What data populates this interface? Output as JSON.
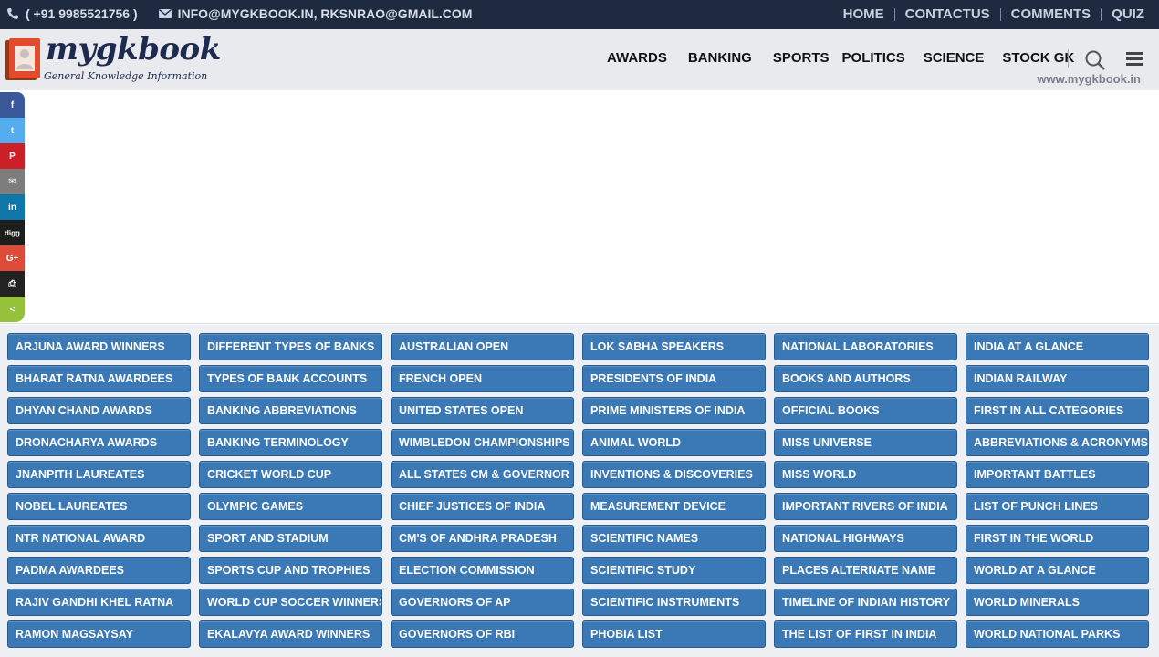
{
  "topbar": {
    "phone": "( +91 9985521756 )",
    "email": "INFO@MYGKBOOK.IN, RKSNRAO@GMAIL.COM",
    "nav": [
      "HOME",
      "CONTACTUS",
      "COMMENTS",
      "QUIZ"
    ]
  },
  "header": {
    "logo_title": "mygkbook",
    "logo_subtitle": "General Knowledge Information",
    "nav": [
      "AWARDS",
      "BANKING",
      "SPORTS",
      "POLITICS",
      "SCIENCE",
      "STOCK GK"
    ],
    "site_url": "www.mygkbook.in"
  },
  "share": [
    {
      "name": "facebook",
      "glyph": "f",
      "color": "#3b5998"
    },
    {
      "name": "twitter",
      "glyph": "t",
      "color": "#55acee"
    },
    {
      "name": "pinterest",
      "glyph": "P",
      "color": "#cb2027"
    },
    {
      "name": "email",
      "glyph": "✉",
      "color": "#7d7d7d"
    },
    {
      "name": "linkedin",
      "glyph": "in",
      "color": "#0e76a8"
    },
    {
      "name": "digg",
      "glyph": "digg",
      "color": "#1d1d1b"
    },
    {
      "name": "google-plus",
      "glyph": "G+",
      "color": "#dd4b39"
    },
    {
      "name": "print",
      "glyph": "⎙",
      "color": "#222222"
    },
    {
      "name": "share",
      "glyph": "<",
      "color": "#95c13d"
    }
  ],
  "link_columns": [
    [
      "ARJUNA AWARD WINNERS",
      "BHARAT RATNA AWARDEES",
      "DHYAN CHAND AWARDS",
      "DRONACHARYA AWARDS",
      "JNANPITH LAUREATES",
      "NOBEL LAUREATES",
      "NTR NATIONAL AWARD",
      "PADMA AWARDEES",
      "RAJIV GANDHI KHEL RATNA",
      "RAMON MAGSAYSAY"
    ],
    [
      "DIFFERENT TYPES OF BANKS",
      "TYPES OF BANK ACCOUNTS",
      "BANKING ABBREVIATIONS",
      "BANKING TERMINOLOGY",
      "CRICKET WORLD CUP",
      "OLYMPIC GAMES",
      "SPORT AND STADIUM",
      "SPORTS CUP AND TROPHIES",
      "WORLD CUP SOCCER WINNERS",
      "EKALAVYA AWARD WINNERS"
    ],
    [
      "AUSTRALIAN OPEN",
      "FRENCH OPEN",
      "UNITED STATES OPEN",
      "WIMBLEDON CHAMPIONSHIPS",
      "ALL STATES CM & GOVERNOR",
      "CHIEF JUSTICES OF INDIA",
      "CM'S OF ANDHRA PRADESH",
      "ELECTION COMMISSION",
      "GOVERNORS OF AP",
      "GOVERNORS OF RBI"
    ],
    [
      "LOK SABHA SPEAKERS",
      "PRESIDENTS OF INDIA",
      "PRIME MINISTERS OF INDIA",
      "ANIMAL WORLD",
      "INVENTIONS & DISCOVERIES",
      "MEASUREMENT DEVICE",
      "SCIENTIFIC NAMES",
      "SCIENTIFIC STUDY",
      "SCIENTIFIC INSTRUMENTS",
      "PHOBIA LIST"
    ],
    [
      "NATIONAL LABORATORIES",
      "BOOKS AND AUTHORS",
      "OFFICIAL BOOKS",
      "MISS UNIVERSE",
      "MISS WORLD",
      "IMPORTANT RIVERS OF INDIA",
      "NATIONAL HIGHWAYS",
      "PLACES ALTERNATE NAME",
      "TIMELINE OF INDIAN HISTORY",
      "THE LIST OF FIRST IN INDIA"
    ],
    [
      "INDIA AT A GLANCE",
      "INDIAN RAILWAY",
      "FIRST IN ALL CATEGORIES",
      "ABBREVIATIONS & ACRONYMS",
      "IMPORTANT BATTLES",
      "LIST OF PUNCH LINES",
      "FIRST IN THE WORLD",
      "WORLD AT A GLANCE",
      "WORLD MINERALS",
      "WORLD NATIONAL PARKS"
    ]
  ]
}
